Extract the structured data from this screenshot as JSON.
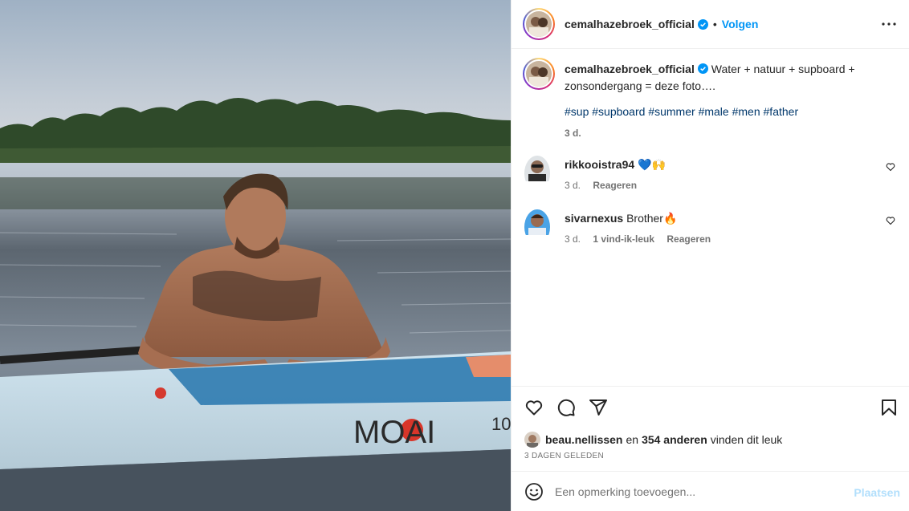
{
  "photo": {
    "alt": "",
    "board_brand": "MOAI",
    "board_number": "10"
  },
  "header": {
    "username": "cemalhazebroek_official",
    "separator": "•",
    "follow_label": "Volgen"
  },
  "caption": {
    "username": "cemalhazebroek_official",
    "text": "Water + natuur + supboard + zonsondergang = deze foto….",
    "hashtags": [
      "#sup",
      "#supboard",
      "#summer",
      "#male",
      "#men",
      "#father"
    ],
    "time": "3 d."
  },
  "comments": [
    {
      "username": "rikkooistra94",
      "text": "💙🙌",
      "time": "3 d.",
      "likes": "",
      "reply_label": "Reageren"
    },
    {
      "username": "sivarnexus",
      "text": "Brother🔥",
      "time": "3 d.",
      "likes": "1 vind-ik-leuk",
      "reply_label": "Reageren"
    }
  ],
  "likes": {
    "first_user": "beau.nellissen",
    "joiner": "en",
    "others": "354 anderen",
    "suffix": "vinden dit leuk"
  },
  "date": "3 DAGEN GELEDEN",
  "add_comment": {
    "placeholder": "Een opmerking toevoegen...",
    "post_label": "Plaatsen"
  },
  "colors": {
    "accent": "#0095f6",
    "hashtag": "#00376b",
    "muted": "#737373",
    "post_disabled": "#b2dffc"
  }
}
